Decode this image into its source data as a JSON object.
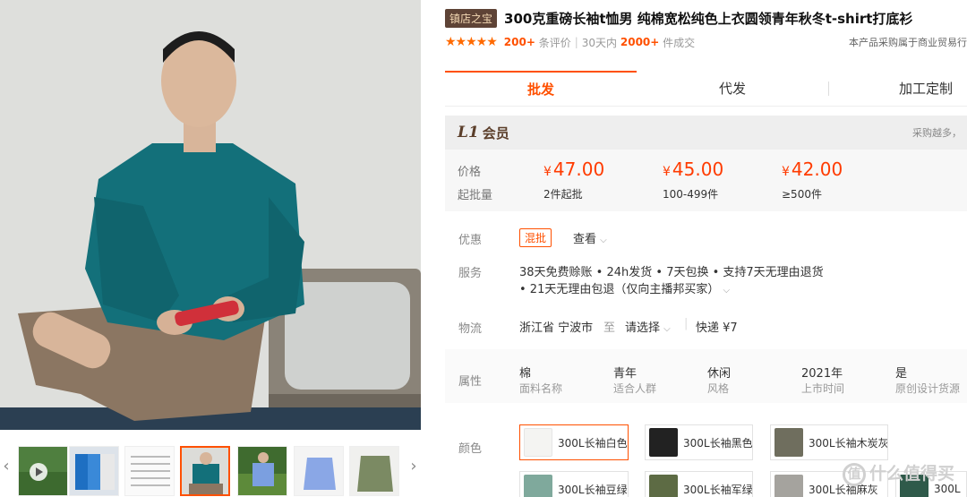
{
  "title": {
    "badge": "镇店之宝",
    "text": "300克重磅长袖t恤男 纯棉宽松纯色上衣圆领青年秋冬t-shirt打底衫"
  },
  "rating": {
    "stars": "★★★★★",
    "reviews_count": "200+",
    "reviews_label": "条评价",
    "sep": "|",
    "period": "30天内",
    "sales_count": "2000+",
    "sales_label": "件成交",
    "note": "本产品采购属于商业贸易行"
  },
  "tabs": [
    "批发",
    "代发",
    "加工定制"
  ],
  "member": {
    "level": "L1",
    "label": "会员",
    "buy_more": "采购越多，"
  },
  "prices": {
    "price_label": "价格",
    "moq_label": "起批量",
    "currency": "¥",
    "tiers": [
      {
        "price": "47.00",
        "qty": "2件起批"
      },
      {
        "price": "45.00",
        "qty": "100-499件"
      },
      {
        "price": "42.00",
        "qty": "≥500件"
      }
    ]
  },
  "promo": {
    "label": "优惠",
    "tag": "混批",
    "view": "查看"
  },
  "service": {
    "label": "服务",
    "line1": "38天免费赊账 • 24h发货 • 7天包换 • 支持7天无理由退货",
    "line2": "• 21天无理由包退（仅向主播邦买家）"
  },
  "logistics": {
    "label": "物流",
    "from": "浙江省 宁波市",
    "to_word": "至",
    "select": "请选择",
    "shipping": "快递 ¥7"
  },
  "attributes": {
    "label": "属性",
    "items": [
      {
        "value": "棉",
        "name": "面料名称"
      },
      {
        "value": "青年",
        "name": "适合人群"
      },
      {
        "value": "休闲",
        "name": "风格"
      },
      {
        "value": "2021年",
        "name": "上市时间"
      },
      {
        "value": "是",
        "name": "原创设计货源"
      }
    ]
  },
  "colors": {
    "label": "颜色",
    "options": [
      {
        "name": "300L长袖白色",
        "swatch": "#f4f4f2"
      },
      {
        "name": "300L长袖黑色",
        "swatch": "#222222"
      },
      {
        "name": "300L长袖木炭灰",
        "swatch": "#6f6e5e"
      },
      {
        "name": "300L长袖豆绿",
        "swatch": "#7fa99c"
      },
      {
        "name": "300L长袖军绿",
        "swatch": "#5d6b44"
      },
      {
        "name": "300L长袖麻灰",
        "swatch": "#a5a39e"
      },
      {
        "name": "300L",
        "swatch": "#2f5a4a"
      }
    ]
  },
  "watermark": {
    "icon": "值",
    "text": "什么值得买"
  },
  "colors_theme": {
    "accent": "#ff5000",
    "member_brown": "#5b3e2a",
    "badge_bg": "#5e4336"
  }
}
